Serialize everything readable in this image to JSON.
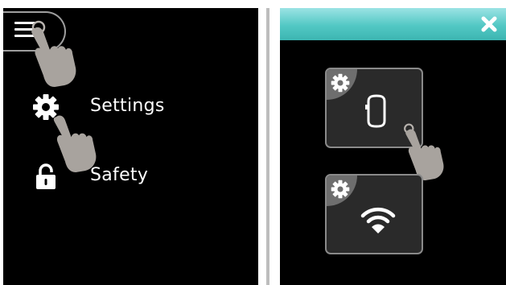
{
  "left": {
    "menu": {
      "items": [
        {
          "label": "Settings",
          "icon": "gear-icon"
        },
        {
          "label": "Safety",
          "icon": "lock-icon"
        }
      ]
    }
  },
  "right": {
    "header": {
      "close_icon": "close-icon",
      "color": "#52c8c4"
    },
    "tiles": [
      {
        "name": "device",
        "icon": "watch-icon",
        "corner_icon": "gear-icon"
      },
      {
        "name": "wifi",
        "icon": "wifi-icon",
        "corner_icon": "gear-icon"
      }
    ]
  }
}
